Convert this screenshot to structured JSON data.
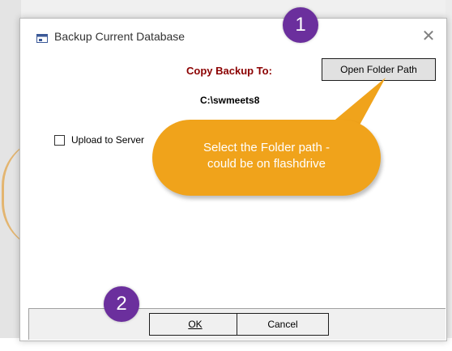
{
  "dialog": {
    "title": "Backup Current Database",
    "close_symbol": "✕",
    "icon": "window-icon"
  },
  "backup": {
    "copy_label": "Copy Backup To:",
    "open_folder_label": "Open Folder Path",
    "path": "C:\\swmeets8"
  },
  "upload": {
    "label": "Upload to Server",
    "checked": false
  },
  "footer": {
    "ok_label": "OK",
    "cancel_label": "Cancel"
  },
  "annotations": {
    "badge_1": "1",
    "badge_2": "2",
    "callout_line1": "Select the Folder path -",
    "callout_line2": "could be on flashdrive",
    "callout_color": "#f0a31b",
    "badge_color": "#6b2f9d"
  }
}
